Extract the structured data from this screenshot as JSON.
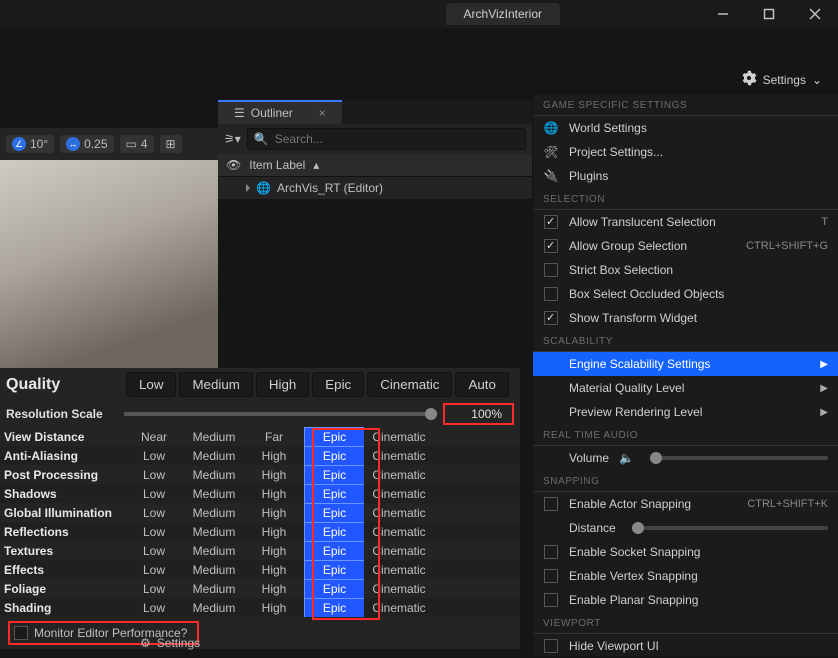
{
  "titlebar": {
    "projectName": "ArchVizInterior"
  },
  "settingsButton": {
    "label": "Settings"
  },
  "outliner": {
    "tabLabel": "Outliner",
    "searchPlaceholder": "Search...",
    "headerLabel": "Item Label",
    "row0": "ArchVis_RT (Editor)"
  },
  "viewportToolbar": {
    "angle": "10°",
    "step": "0.25",
    "cams": "4"
  },
  "quality": {
    "title": "Quality",
    "buttons": {
      "low": "Low",
      "medium": "Medium",
      "high": "High",
      "epic": "Epic",
      "cinematic": "Cinematic",
      "auto": "Auto"
    },
    "resolutionLabel": "Resolution Scale",
    "resolutionValue": "100%",
    "cells": {
      "near": "Near",
      "low": "Low",
      "medium": "Medium",
      "high": "High",
      "far": "Far",
      "epic": "Epic",
      "cinematic": "Cinematic"
    },
    "rows": {
      "viewDistance": "View Distance",
      "antiAliasing": "Anti-Aliasing",
      "postProcessing": "Post Processing",
      "shadows": "Shadows",
      "globalIllumination": "Global Illumination",
      "reflections": "Reflections",
      "textures": "Textures",
      "effects": "Effects",
      "foliage": "Foliage",
      "shading": "Shading"
    },
    "monitorLabel": "Monitor Editor Performance?",
    "bottomSettings": "Settings"
  },
  "flyout": {
    "sections": {
      "gameSpecific": "GAME SPECIFIC SETTINGS",
      "selection": "SELECTION",
      "scalability": "SCALABILITY",
      "realTimeAudio": "REAL TIME AUDIO",
      "snapping": "SNAPPING",
      "viewport": "VIEWPORT"
    },
    "items": {
      "worldSettings": "World Settings",
      "projectSettings": "Project Settings...",
      "plugins": "Plugins",
      "allowTranslucent": "Allow Translucent Selection",
      "allowTranslucentHotkey": "T",
      "allowGroup": "Allow Group Selection",
      "allowGroupHotkey": "CTRL+SHIFT+G",
      "strictBox": "Strict Box Selection",
      "boxOccluded": "Box Select Occluded Objects",
      "showTransform": "Show Transform Widget",
      "engineScalability": "Engine Scalability Settings",
      "materialQuality": "Material Quality Level",
      "previewRendering": "Preview Rendering Level",
      "volume": "Volume",
      "enableActorSnap": "Enable Actor Snapping",
      "enableActorSnapHotkey": "CTRL+SHIFT+K",
      "distance": "Distance",
      "socketSnap": "Enable Socket Snapping",
      "vertexSnap": "Enable Vertex Snapping",
      "planarSnap": "Enable Planar Snapping",
      "hideViewportUI": "Hide Viewport UI"
    }
  }
}
